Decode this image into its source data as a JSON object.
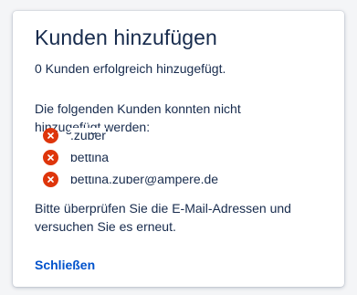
{
  "dialog": {
    "title": "Kunden hinzufügen",
    "success_message": "0 Kunden erfolgreich hinzugefügt.",
    "failed_intro": "Die folgenden Kunden konnten nicht hinzugefügt werden:",
    "failed_customers": [
      {
        "email": ".zuber",
        "icon": "error-icon"
      },
      {
        "email": "bettina",
        "icon": "error-icon"
      },
      {
        "email": "bettina.zuber@ampere.de",
        "icon": "error-icon"
      }
    ],
    "retry_message": "Bitte überprüfen Sie die E-Mail-Adressen und versuchen Sie es erneut.",
    "close_label": "Schließen"
  },
  "colors": {
    "error": "#de350b",
    "link": "#0052cc",
    "text": "#172b4d"
  }
}
